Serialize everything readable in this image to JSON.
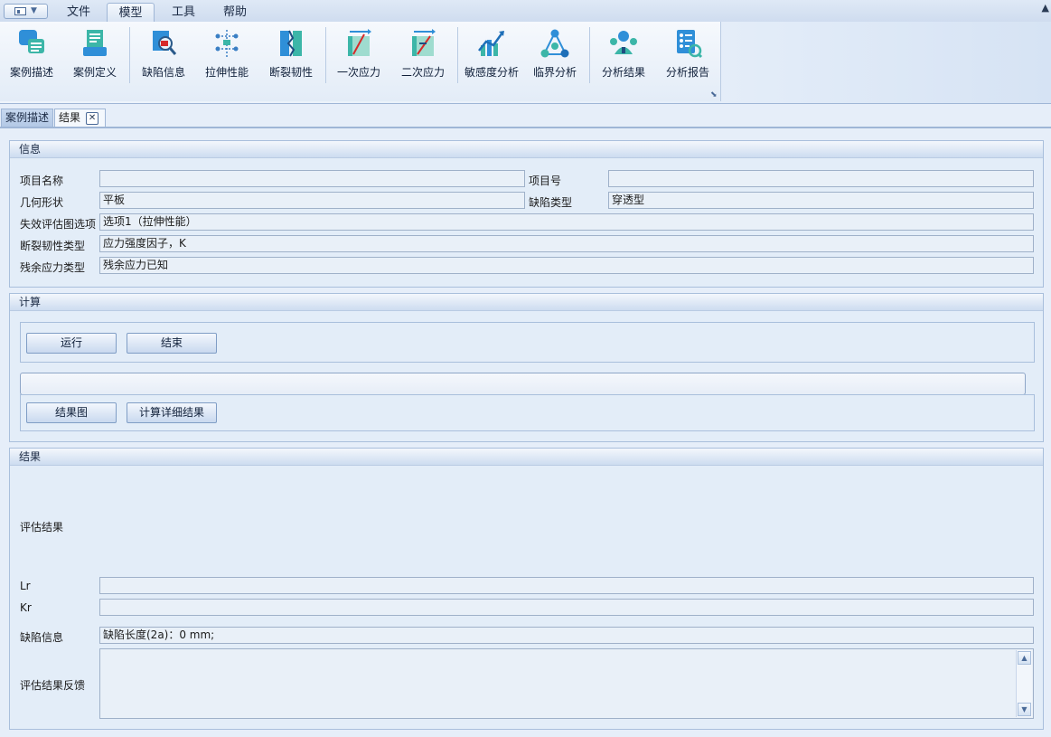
{
  "menu": {
    "tabs": [
      {
        "label": "文件"
      },
      {
        "label": "模型"
      },
      {
        "label": "工具"
      },
      {
        "label": "帮助"
      }
    ],
    "active_tab": "模型"
  },
  "ribbon": {
    "buttons": [
      {
        "label": "案例描述",
        "icon": "case-description-icon"
      },
      {
        "label": "案例定义",
        "icon": "case-definition-icon"
      },
      {
        "label": "缺陷信息",
        "icon": "defect-info-icon"
      },
      {
        "label": "拉伸性能",
        "icon": "tensile-property-icon"
      },
      {
        "label": "断裂韧性",
        "icon": "fracture-toughness-icon"
      },
      {
        "label": "一次应力",
        "icon": "primary-stress-icon"
      },
      {
        "label": "二次应力",
        "icon": "secondary-stress-icon"
      },
      {
        "label": "敏感度分析",
        "icon": "sensitivity-analysis-icon"
      },
      {
        "label": "临界分析",
        "icon": "critical-analysis-icon"
      },
      {
        "label": "分析结果",
        "icon": "analysis-result-icon"
      },
      {
        "label": "分析报告",
        "icon": "analysis-report-icon"
      }
    ]
  },
  "doc_tabs": [
    {
      "label": "案例描述"
    },
    {
      "label": "结果"
    }
  ],
  "info": {
    "title": "信息",
    "project_name_label": "项目名称",
    "project_name_value": "",
    "project_no_label": "项目号",
    "project_no_value": "",
    "geometry_label": "几何形状",
    "geometry_value": "平板",
    "defect_type_label": "缺陷类型",
    "defect_type_value": "穿透型",
    "fad_option_label": "失效评估图选项",
    "fad_option_value": "选项1（拉伸性能）",
    "toughness_type_label": "断裂韧性类型",
    "toughness_type_value": "应力强度因子，K",
    "residual_label": "残余应力类型",
    "residual_value": "残余应力已知"
  },
  "calc": {
    "title": "计算",
    "run_label": "运行",
    "end_label": "结束",
    "progress": 0,
    "chart_label": "结果图",
    "detail_label": "计算详细结果"
  },
  "result": {
    "title": "结果",
    "eval_label": "评估结果",
    "lr_label": "Lr",
    "lr_value": "",
    "kr_label": "Kr",
    "kr_value": "",
    "defect_label": "缺陷信息",
    "defect_value": "缺陷长度(2a)：0 mm;",
    "feedback_label": "评估结果反馈",
    "feedback_value": ""
  }
}
